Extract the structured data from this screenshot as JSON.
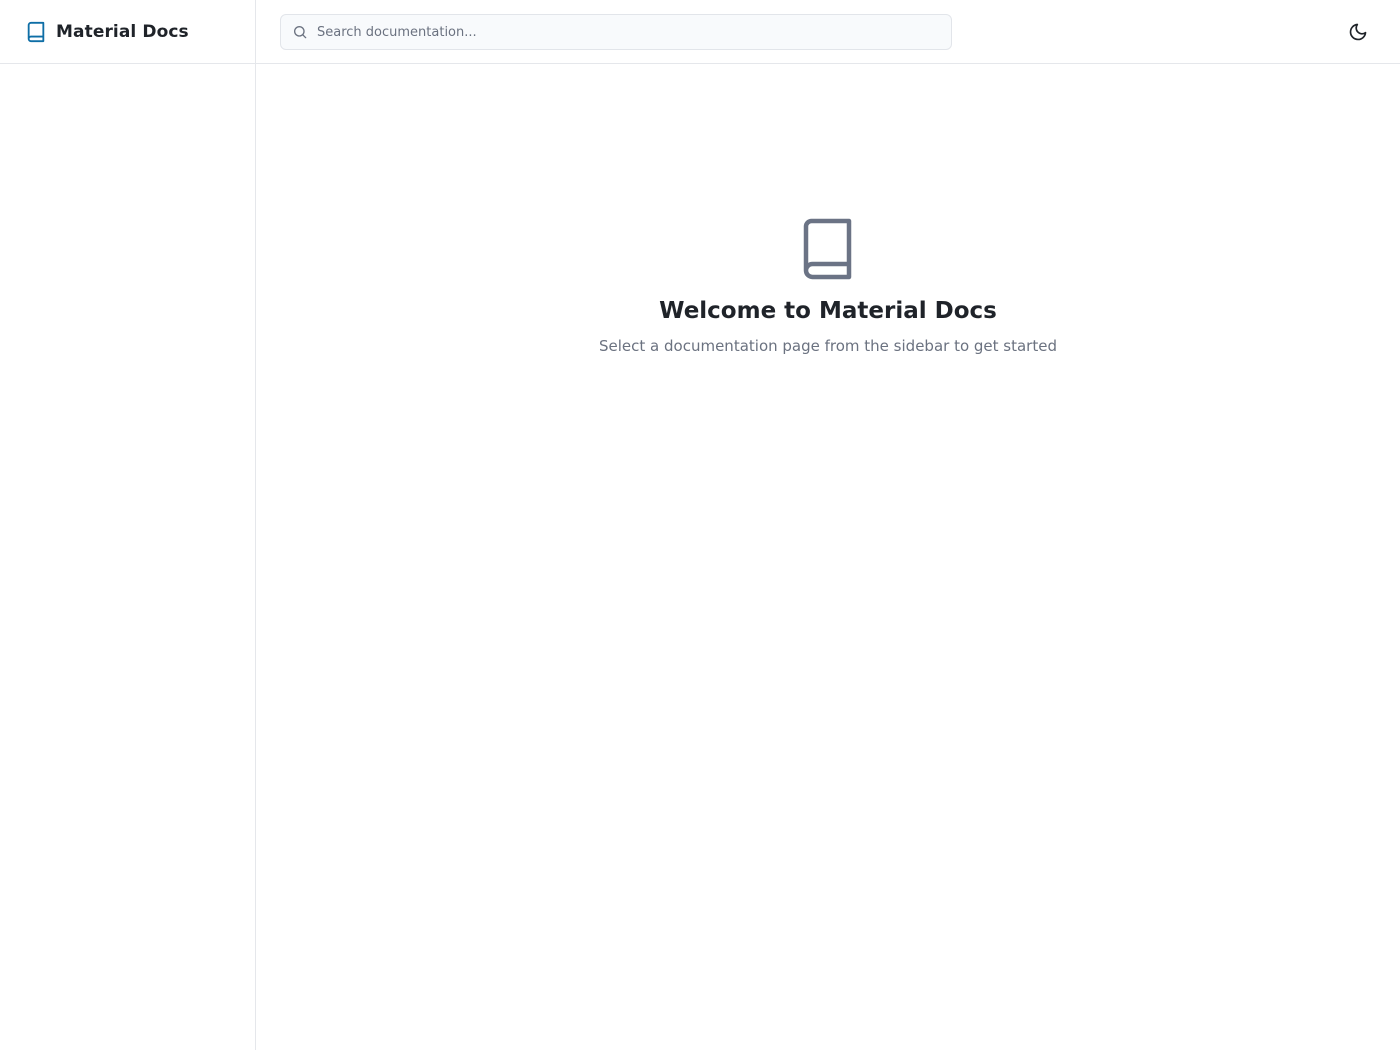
{
  "header": {
    "brand_title": "Material Docs",
    "brand_icon": "book-icon",
    "search": {
      "placeholder": "Search documentation...",
      "value": "",
      "icon": "search-icon"
    },
    "theme_toggle_icon": "moon-icon"
  },
  "sidebar": {
    "items": []
  },
  "main": {
    "welcome_icon": "book-icon",
    "title": "Welcome to Material Docs",
    "subtitle": "Select a documentation page from the sidebar to get started"
  },
  "colors": {
    "accent": "#0e6ea6",
    "text_primary": "#1f2329",
    "text_secondary": "#6b7280",
    "icon_muted": "#6b7385",
    "border": "#e5e7eb",
    "search_bg": "#f8fafc"
  }
}
